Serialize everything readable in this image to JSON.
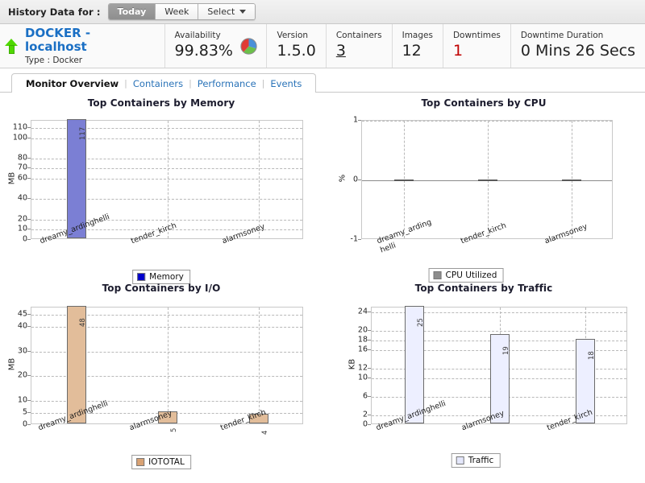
{
  "topbar": {
    "history_label": "History Data for :",
    "ranges": [
      {
        "label": "Today",
        "active": true
      },
      {
        "label": "Week",
        "active": false
      },
      {
        "label": "Select",
        "active": false,
        "has_caret": true
      }
    ]
  },
  "summary": {
    "status_icon": "green-up-arrow-icon",
    "host_name": "DOCKER - localhost",
    "host_type": "Type : Docker",
    "cells": [
      {
        "label": "Availability",
        "value": "99.83%",
        "icon": "pie-chart-icon"
      },
      {
        "label": "Version",
        "value": "1.5.0"
      },
      {
        "label": "Containers",
        "value": "3",
        "style": "link"
      },
      {
        "label": "Images",
        "value": "12"
      },
      {
        "label": "Downtimes",
        "value": "1",
        "style": "alert"
      },
      {
        "label": "Downtime Duration",
        "value": "0 Mins 26 Secs"
      }
    ]
  },
  "tabs": [
    {
      "label": "Monitor Overview",
      "active": true
    },
    {
      "label": "Containers",
      "active": false
    },
    {
      "label": "Performance",
      "active": false
    },
    {
      "label": "Events",
      "active": false
    }
  ],
  "colors": {
    "memory_bar": "#7b7fd4",
    "memory_legend": "#0000cc",
    "io_bar": "#e2bd9a",
    "io_legend": "#d9a273",
    "traffic_bar": "#edefff",
    "traffic_legend": "#e4e7fb",
    "cpu_legend": "#8c8c8c",
    "accent_blue": "#1a6fc4",
    "alert_red": "#c00000"
  },
  "chart_data": [
    {
      "id": "memory",
      "type": "bar",
      "title": "Top Containers by Memory",
      "xlabel": "",
      "ylabel": "MB",
      "ylim": [
        0,
        117
      ],
      "yticks": [
        0,
        10,
        20,
        40,
        60,
        70,
        80,
        100,
        110
      ],
      "grid": true,
      "legend": "Memory",
      "legend_position": "bottom-center",
      "categories": [
        "dreamy_ardinghelli",
        "tender_kirch",
        "alarmsoney"
      ],
      "values": [
        117,
        0,
        0
      ],
      "value_labels": [
        "117",
        "",
        ""
      ]
    },
    {
      "id": "cpu",
      "type": "bar",
      "title": "Top Containers by CPU",
      "xlabel": "",
      "ylabel": "%",
      "ylim": [
        -1,
        1
      ],
      "yticks": [
        -1,
        0,
        1
      ],
      "grid": true,
      "legend": "CPU Utilized",
      "legend_position": "bottom-center",
      "categories": [
        "dreamy_arding\nhelli",
        "tender_kirch",
        "alarmsoney"
      ],
      "values": [
        0,
        0,
        0
      ],
      "value_labels": [
        "",
        "",
        ""
      ]
    },
    {
      "id": "io",
      "type": "bar",
      "title": "Top Containers by I/O",
      "xlabel": "",
      "ylabel": "MB",
      "ylim": [
        0,
        48
      ],
      "yticks": [
        0,
        5,
        10,
        20,
        30,
        40,
        45
      ],
      "grid": true,
      "legend": "IOTOTAL",
      "legend_position": "bottom-center",
      "categories": [
        "dreamy_ardinghelli",
        "alarmsoney",
        "tender_kirch"
      ],
      "values": [
        48,
        5,
        4
      ],
      "value_labels": [
        "48",
        "5",
        "4"
      ]
    },
    {
      "id": "traffic",
      "type": "bar",
      "title": "Top Containers by Traffic",
      "xlabel": "",
      "ylabel": "KB",
      "ylim": [
        0,
        25
      ],
      "yticks": [
        0,
        2,
        6,
        10,
        12,
        16,
        18,
        20,
        24
      ],
      "grid": true,
      "legend": "Traffic",
      "legend_position": "bottom-center",
      "categories": [
        "dreamy_ardinghelli",
        "alarmsoney",
        "tender_kirch"
      ],
      "values": [
        25,
        19,
        18
      ],
      "value_labels": [
        "25",
        "19",
        "18"
      ]
    }
  ]
}
